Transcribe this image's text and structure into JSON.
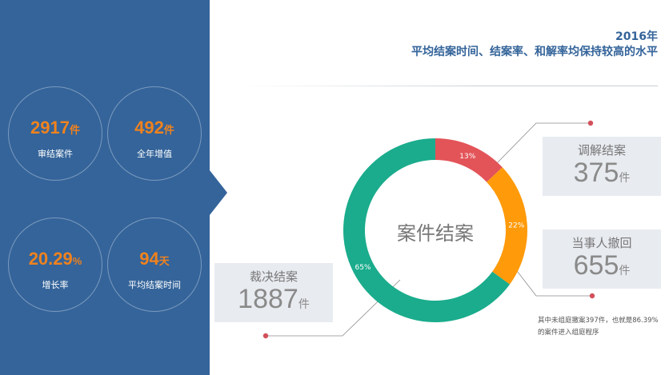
{
  "header": {
    "year": "2016年",
    "subtitle": "平均结案时间、结案率、和解率均保持较高的水平"
  },
  "stats": [
    {
      "value": "2917",
      "unit": "件",
      "label": "审结案件"
    },
    {
      "value": "492",
      "unit": "件",
      "label": "全年增值"
    },
    {
      "value": "20.29",
      "unit": "%",
      "label": "增长率"
    },
    {
      "value": "94",
      "unit": "天",
      "label": "平均结案时间"
    }
  ],
  "callouts": {
    "mediation": {
      "label": "调解结案",
      "value": "375",
      "unit": "件"
    },
    "withdrawal": {
      "label": "当事人撤回",
      "value": "655",
      "unit": "件"
    },
    "adjudication": {
      "label": "裁决结案",
      "value": "1887",
      "unit": "件"
    }
  },
  "note": "其中未组庭撤案397件，也就是86.39%的案件进入组庭程序",
  "colors": {
    "panel": "#34649a",
    "accent": "#f0821e",
    "mediation": "#e35459",
    "withdrawal": "#ff9a0a",
    "adjudication": "#1aac8c"
  },
  "chart_data": {
    "type": "pie",
    "center_label": "案件结案",
    "slices": [
      {
        "label": "调解结案",
        "value": 13,
        "display": "13%",
        "color": "#e35459"
      },
      {
        "label": "当事人撤回",
        "value": 22,
        "display": "22%",
        "color": "#ff9a0a"
      },
      {
        "label": "裁决结案",
        "value": 65,
        "display": "65%",
        "color": "#1aac8c"
      }
    ]
  }
}
